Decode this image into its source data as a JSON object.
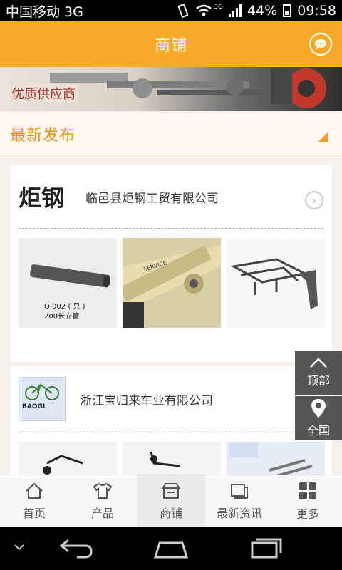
{
  "status_bar": {
    "carrier": "中国移动 3G",
    "network": "3G",
    "battery": "44%",
    "time": "09:58"
  },
  "header": {
    "title": "商铺"
  },
  "banner": {
    "tag": "优质供应商"
  },
  "section": {
    "title": "最新发布"
  },
  "shops": [
    {
      "logo_text": "炬钢",
      "name": "临邑县炬钢工贸有限公司",
      "products": [
        {
          "caption_line1": "Q 002 ( 只 )",
          "caption_line2": "200长立管"
        },
        {
          "caption_line1": "",
          "caption_line2": "",
          "print": "SERVICE"
        },
        {
          "caption_line1": "",
          "caption_line2": ""
        }
      ]
    },
    {
      "logo_text": "BAOGL",
      "name": "浙江宝归来车业有限公司",
      "products": [
        {
          "caption_line1": "",
          "caption_line2": ""
        },
        {
          "caption_line1": "",
          "caption_line2": ""
        },
        {
          "caption_line1": "",
          "caption_line2": ""
        }
      ]
    }
  ],
  "floating": {
    "top": "顶部",
    "all": "全国"
  },
  "bottom_nav": {
    "items": [
      {
        "label": "首页",
        "icon": "home-icon"
      },
      {
        "label": "产品",
        "icon": "shirt-icon"
      },
      {
        "label": "商铺",
        "icon": "shop-icon",
        "active": true
      },
      {
        "label": "最新资讯",
        "icon": "news-icon"
      },
      {
        "label": "更多",
        "icon": "grid-icon"
      }
    ]
  },
  "colors": {
    "accent": "#f7a928",
    "section_text": "#e8901e"
  }
}
